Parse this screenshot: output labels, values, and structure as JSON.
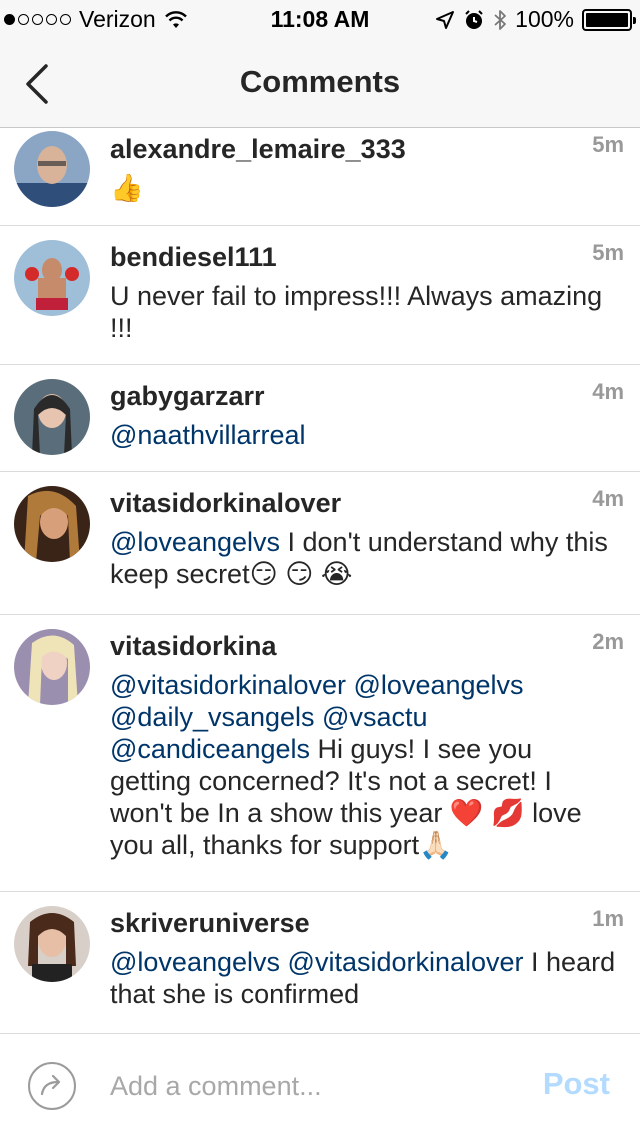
{
  "status_bar": {
    "carrier": "Verizon",
    "time": "11:08 AM",
    "battery": "100%",
    "signal_filled_dots": 1,
    "signal_total_dots": 5
  },
  "nav": {
    "title": "Comments",
    "back_icon": "chevron-left-icon"
  },
  "comments": [
    {
      "username": "alexandre_lemaire_333",
      "time": "5m",
      "segments": [
        {
          "text": "👍",
          "mention": false
        }
      ]
    },
    {
      "username": "bendiesel111",
      "time": "5m",
      "segments": [
        {
          "text": "U never fail to impress!!! Always amazing !!!",
          "mention": false
        }
      ]
    },
    {
      "username": "gabygarzarr",
      "time": "4m",
      "segments": [
        {
          "text": "@naathvillarreal",
          "mention": true
        }
      ]
    },
    {
      "username": "vitasidorkinalover",
      "time": "4m",
      "segments": [
        {
          "text": "@loveangelvs",
          "mention": true
        },
        {
          "text": " I don't understand why this keep secret😏 😏 😭",
          "mention": false
        }
      ]
    },
    {
      "username": "vitasidorkina",
      "time": "2m",
      "segments": [
        {
          "text": "@vitasidorkinalover",
          "mention": true
        },
        {
          "text": " ",
          "mention": false
        },
        {
          "text": "@loveangelvs",
          "mention": true
        },
        {
          "text": " ",
          "mention": false
        },
        {
          "text": "@daily_vsangels",
          "mention": true
        },
        {
          "text": " ",
          "mention": false
        },
        {
          "text": "@vsactu",
          "mention": true
        },
        {
          "text": " ",
          "mention": false
        },
        {
          "text": "@candiceangels",
          "mention": true
        },
        {
          "text": " Hi guys! I see you getting concerned? It's not a secret! I won't be In a show this year ❤️ 💋  love you all, thanks for support🙏🏻",
          "mention": false
        }
      ]
    },
    {
      "username": "skriveruniverse",
      "time": "1m",
      "segments": [
        {
          "text": "@loveangelvs",
          "mention": true
        },
        {
          "text": " ",
          "mention": false
        },
        {
          "text": "@vitasidorkinalover",
          "mention": true
        },
        {
          "text": " I heard that she is confirmed",
          "mention": false
        }
      ]
    }
  ],
  "composer": {
    "placeholder": "Add a comment...",
    "value": "",
    "post_label": "Post",
    "share_icon": "share-arrow-icon"
  },
  "colors": {
    "mention": "#003569",
    "post_disabled": "#b3dbff",
    "timestamp": "#999999",
    "bar_bg": "#f7f7f7"
  }
}
